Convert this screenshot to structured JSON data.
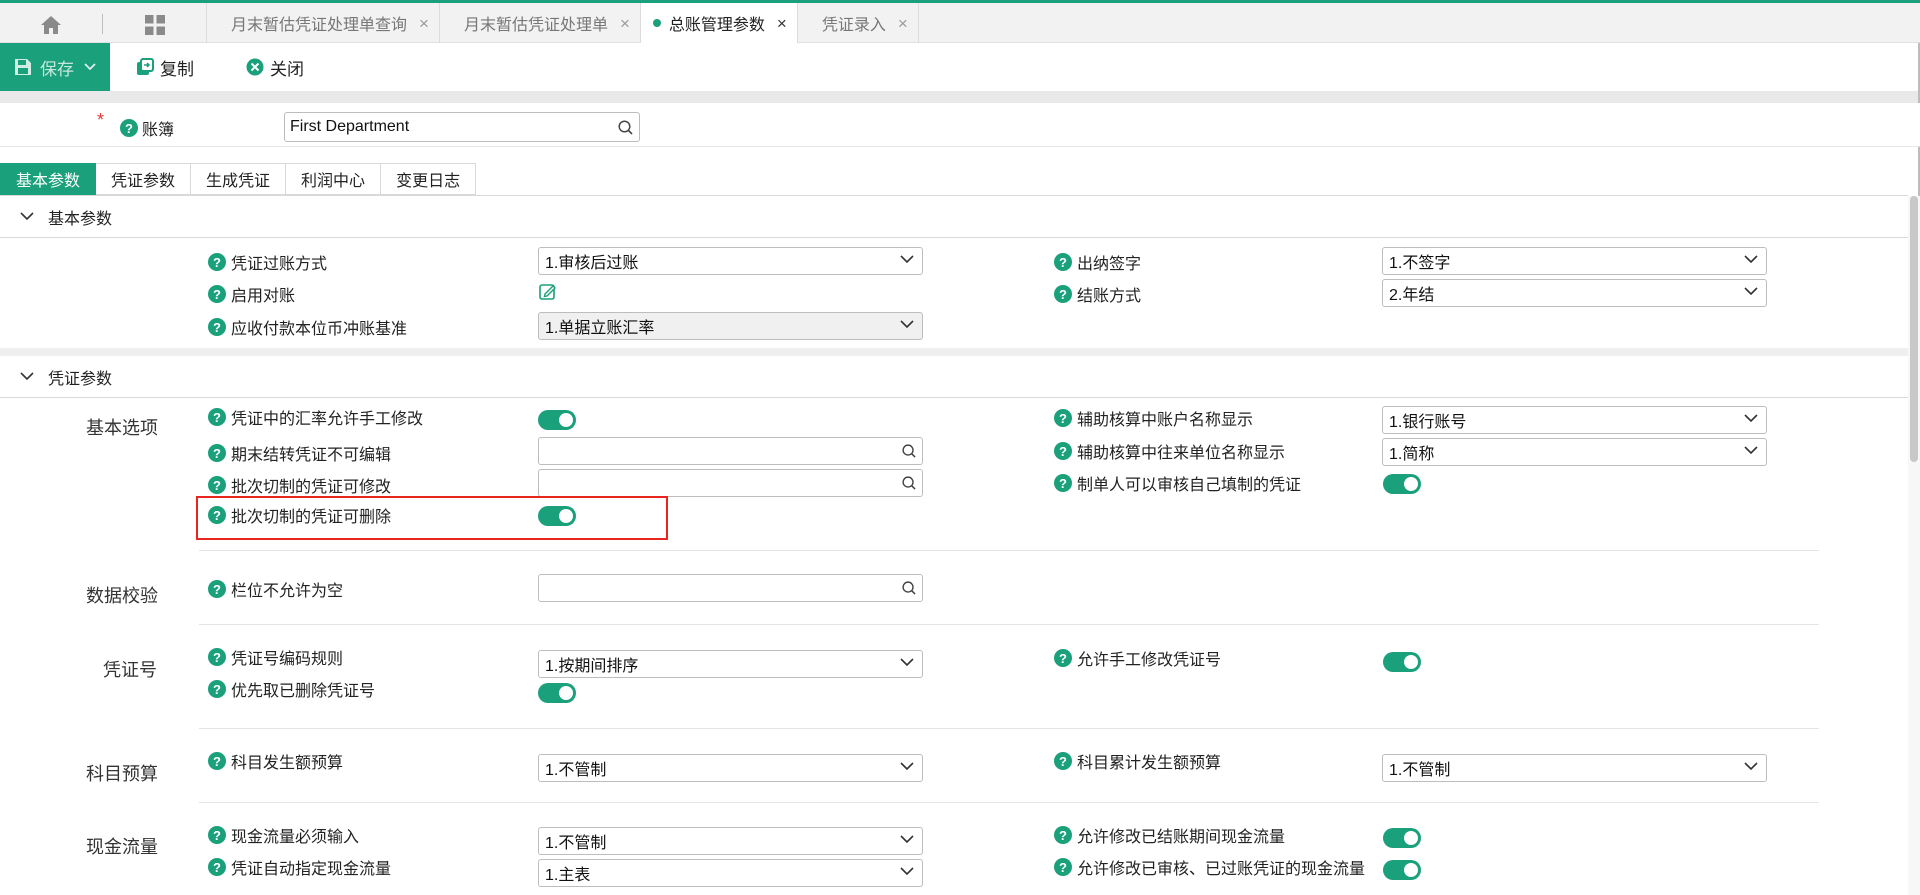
{
  "tabbar": {
    "tabs": [
      {
        "label": "月末暂估凭证处理单查询",
        "active": false
      },
      {
        "label": "月末暂估凭证处理单",
        "active": false
      },
      {
        "label": "总账管理参数",
        "active": true
      },
      {
        "label": "凭证录入",
        "active": false
      }
    ],
    "close_glyph": "×"
  },
  "toolbar": {
    "save_label": "保存",
    "copy_label": "复制",
    "close_label": "关闭"
  },
  "ledger": {
    "required_mark": "*",
    "label": "账簿",
    "value": "First Department"
  },
  "section_tabs": [
    "基本参数",
    "凭证参数",
    "生成凭证",
    "利润中心",
    "变更日志"
  ],
  "panel_basic": {
    "title": "基本参数",
    "fields": {
      "posting_method": {
        "label": "凭证过账方式",
        "value": "1.审核后过账"
      },
      "cashier_sign": {
        "label": "出纳签字",
        "value": "1.不签字"
      },
      "enable_reconcile": {
        "label": "启用对账"
      },
      "closing_method": {
        "label": "结账方式",
        "value": "2.年结"
      },
      "ar_ap_rate": {
        "label": "应收付款本位币冲账基准",
        "value": "1.单据立账汇率"
      }
    }
  },
  "panel_voucher": {
    "title": "凭证参数",
    "groups": {
      "basic_options": "基本选项",
      "data_check": "数据校验",
      "voucher_no": "凭证号",
      "subject_budget": "科目预算",
      "cash_flow": "现金流量"
    },
    "fields": {
      "rate_manual_edit": {
        "label": "凭证中的汇率允许手工修改",
        "on": true
      },
      "aux_account_name": {
        "label": "辅助核算中账户名称显示",
        "value": "1.银行账号"
      },
      "period_end_not_editable": {
        "label": "期末结转凭证不可编辑"
      },
      "aux_partner_name": {
        "label": "辅助核算中往来单位名称显示",
        "value": "1.简称"
      },
      "batch_editable": {
        "label": "批次切制的凭证可修改"
      },
      "creator_can_audit": {
        "label": "制单人可以审核自己填制的凭证",
        "on": true
      },
      "batch_deletable": {
        "label": "批次切制的凭证可删除",
        "on": true
      },
      "field_not_empty": {
        "label": "栏位不允许为空"
      },
      "voucher_no_rule": {
        "label": "凭证号编码规则",
        "value": "1.按期间排序"
      },
      "manual_voucher_no": {
        "label": "允许手工修改凭证号",
        "on": true
      },
      "reuse_deleted_no": {
        "label": "优先取已删除凭证号",
        "on": true
      },
      "subject_amount_budget": {
        "label": "科目发生额预算",
        "value": "1.不管制"
      },
      "subject_cumulative_budget": {
        "label": "科目累计发生额预算",
        "value": "1.不管制"
      },
      "cashflow_required": {
        "label": "现金流量必须输入",
        "value": "1.不管制"
      },
      "modify_closed_cashflow": {
        "label": "允许修改已结账期间现金流量",
        "on": true
      },
      "auto_cashflow": {
        "label": "凭证自动指定现金流量",
        "value": "1.主表"
      },
      "modify_posted_cashflow": {
        "label": "允许修改已审核、已过账凭证的现金流量",
        "on": true
      }
    }
  },
  "colors": {
    "accent": "#1aa07a",
    "highlight": "#e8261e",
    "required": "#e53935"
  }
}
